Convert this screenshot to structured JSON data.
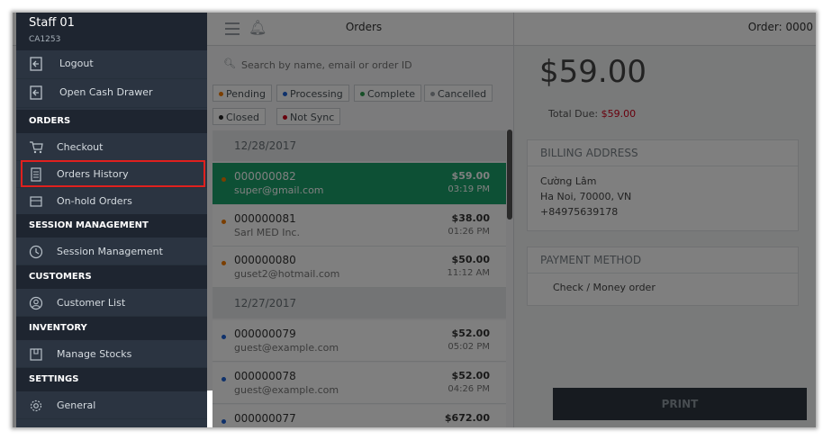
{
  "sidebar": {
    "staff_name": "Staff 01",
    "staff_code": "CA1253",
    "top_items": [
      {
        "label": "Logout",
        "icon": "logout-icon"
      },
      {
        "label": "Open Cash Drawer",
        "icon": "cash-drawer-icon"
      }
    ],
    "sections": {
      "orders": "ORDERS",
      "session": "SESSION MANAGEMENT",
      "customers": "CUSTOMERS",
      "inventory": "INVENTORY",
      "settings": "SETTINGS"
    },
    "items": {
      "checkout": "Checkout",
      "orders_history": "Orders History",
      "onhold": "On-hold Orders",
      "session_management": "Session Management",
      "customer_list": "Customer List",
      "manage_stocks": "Manage Stocks",
      "general": "General"
    },
    "highlight_color": "#e0201e"
  },
  "orders_panel": {
    "title": "Orders",
    "search_placeholder": "Search by name, email or order ID",
    "filters": [
      {
        "label": "Pending",
        "color": "#f57c00"
      },
      {
        "label": "Processing",
        "color": "#1e63d6"
      },
      {
        "label": "Complete",
        "color": "#2e9e4f"
      },
      {
        "label": "Cancelled",
        "color": "#9aa1a7"
      },
      {
        "label": "Closed",
        "color": "#222222"
      },
      {
        "label": "Not Sync",
        "color": "#d0021b"
      }
    ],
    "groups": [
      {
        "date": "12/28/2017",
        "orders": [
          {
            "number": "000000082",
            "email": "super@gmail.com",
            "amount": "$59.00",
            "time": "03:19 PM",
            "status_color": "#f57c00",
            "selected": true
          },
          {
            "number": "000000081",
            "email": "Sarl MED Inc.",
            "amount": "$38.00",
            "time": "01:26 PM",
            "status_color": "#f57c00",
            "selected": false
          },
          {
            "number": "000000080",
            "email": "guset2@hotmail.com",
            "amount": "$50.00",
            "time": "11:12 AM",
            "status_color": "#f57c00",
            "selected": false
          }
        ]
      },
      {
        "date": "12/27/2017",
        "orders": [
          {
            "number": "000000079",
            "email": "guest@example.com",
            "amount": "$52.00",
            "time": "05:02 PM",
            "status_color": "#1e63d6",
            "selected": false
          },
          {
            "number": "000000078",
            "email": "guest@example.com",
            "amount": "$52.00",
            "time": "04:26 PM",
            "status_color": "#1e63d6",
            "selected": false
          },
          {
            "number": "000000077",
            "email": "",
            "amount": "$672.00",
            "time": "",
            "status_color": "#1e63d6",
            "selected": false
          }
        ]
      }
    ]
  },
  "detail": {
    "order_label": "Order: 0000",
    "total": "$59.00",
    "total_due_label": "Total Due:",
    "total_due_value": "$59.00",
    "billing_title": "BILLING ADDRESS",
    "billing_lines": [
      "Cường Lâm",
      "Ha Noi, 70000, VN",
      "+84975639178"
    ],
    "payment_title": "PAYMENT METHOD",
    "payment_value": "Check / Money order",
    "print_label": "PRINT"
  }
}
